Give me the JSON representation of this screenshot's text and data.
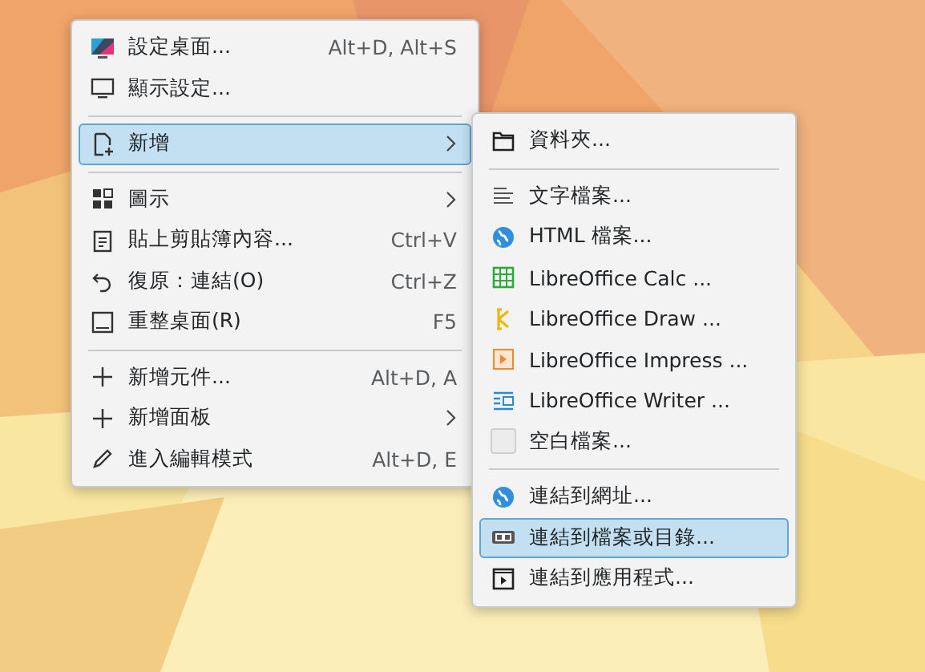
{
  "desktop_menu": {
    "sections": [
      {
        "items": [
          {
            "label": "設定桌面...",
            "shortcut": "Alt+D, Alt+S",
            "has_submenu": false,
            "selected": false
          },
          {
            "label": "顯示設定...",
            "has_submenu": false,
            "selected": false
          }
        ]
      },
      {
        "items": [
          {
            "label": "新增",
            "has_submenu": true,
            "selected": true
          }
        ]
      },
      {
        "items": [
          {
            "label": "圖示",
            "has_submenu": true,
            "selected": false
          },
          {
            "label": "貼上剪貼簿內容...",
            "shortcut": "Ctrl+V",
            "has_submenu": false,
            "selected": false
          },
          {
            "label": "復原：連結(O)",
            "shortcut": "Ctrl+Z",
            "has_submenu": false,
            "selected": false
          },
          {
            "label": "重整桌面(R)",
            "shortcut": "F5",
            "has_submenu": false,
            "selected": false
          }
        ]
      },
      {
        "items": [
          {
            "label": "新增元件...",
            "shortcut": "Alt+D, A",
            "has_submenu": false,
            "selected": false
          },
          {
            "label": "新增面板",
            "has_submenu": true,
            "selected": false
          },
          {
            "label": "進入編輯模式",
            "shortcut": "Alt+D, E",
            "has_submenu": false,
            "selected": false
          }
        ]
      }
    ]
  },
  "new_submenu": {
    "sections": [
      {
        "items": [
          {
            "label": "資料夾...",
            "selected": false
          }
        ]
      },
      {
        "items": [
          {
            "label": "文字檔案...",
            "selected": false
          },
          {
            "label": "HTML 檔案...",
            "selected": false
          },
          {
            "label": "LibreOffice Calc  ...",
            "selected": false
          },
          {
            "label": "LibreOffice Draw  ...",
            "selected": false
          },
          {
            "label": "LibreOffice Impress  ...",
            "selected": false
          },
          {
            "label": "LibreOffice Writer  ...",
            "selected": false
          },
          {
            "label": "空白檔案...",
            "selected": false
          }
        ]
      },
      {
        "items": [
          {
            "label": "連結到網址...",
            "selected": false
          },
          {
            "label": "連結到檔案或目錄...",
            "selected": true
          },
          {
            "label": "連結到應用程式...",
            "selected": false
          }
        ]
      }
    ]
  }
}
